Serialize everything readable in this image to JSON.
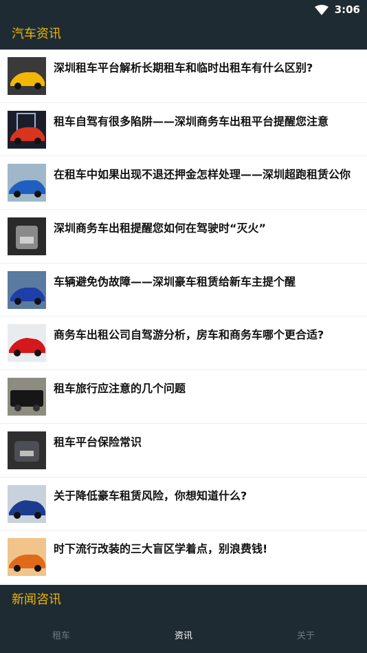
{
  "status_bar": {
    "time": "3:06"
  },
  "app_bar": {
    "title": "汽车资讯"
  },
  "news": [
    {
      "title": "深圳租车平台解析长期租车和临时出租车有什么区别?",
      "thumb_colors": [
        "#3a3a3a",
        "#f2b705"
      ]
    },
    {
      "title": "租车自驾有很多陷阱——深圳商务车出租平台提醒您注意",
      "thumb_colors": [
        "#1b1e2a",
        "#d8341f"
      ]
    },
    {
      "title": "在租车中如果出现不退还押金怎样处理——深圳超跑租赁公你",
      "thumb_colors": [
        "#9fb7c9",
        "#1f5fbf"
      ]
    },
    {
      "title": "深圳商务车出租提醒您如何在驾驶时“灭火”",
      "thumb_colors": [
        "#2a2a2a",
        "#8a8a8a"
      ]
    },
    {
      "title": "车辆避免伪故障——深圳豪车租赁给新车主提个醒",
      "thumb_colors": [
        "#5a7aa0",
        "#1e3fa8"
      ]
    },
    {
      "title": "商务车出租公司自驾游分析，房车和商务车哪个更合适?",
      "thumb_colors": [
        "#e9ecef",
        "#d4181c"
      ]
    },
    {
      "title": "租车旅行应注意的几个问题",
      "thumb_colors": [
        "#8c8c80",
        "#161616"
      ]
    },
    {
      "title": "租车平台保险常识",
      "thumb_colors": [
        "#2f2f2f",
        "#4d4d55"
      ]
    },
    {
      "title": "关于降低豪车租赁风险，你想知道什么?",
      "thumb_colors": [
        "#c7d2dd",
        "#1b3b8f"
      ]
    },
    {
      "title": "时下流行改装的三大盲区学着点，别浪费钱!",
      "thumb_colors": [
        "#f0c48a",
        "#e06a1a"
      ]
    }
  ],
  "section": {
    "title": "新闻咨讯"
  },
  "bottom_nav": [
    {
      "label": "租车",
      "active": false
    },
    {
      "label": "资讯",
      "active": true
    },
    {
      "label": "关于",
      "active": false
    }
  ]
}
